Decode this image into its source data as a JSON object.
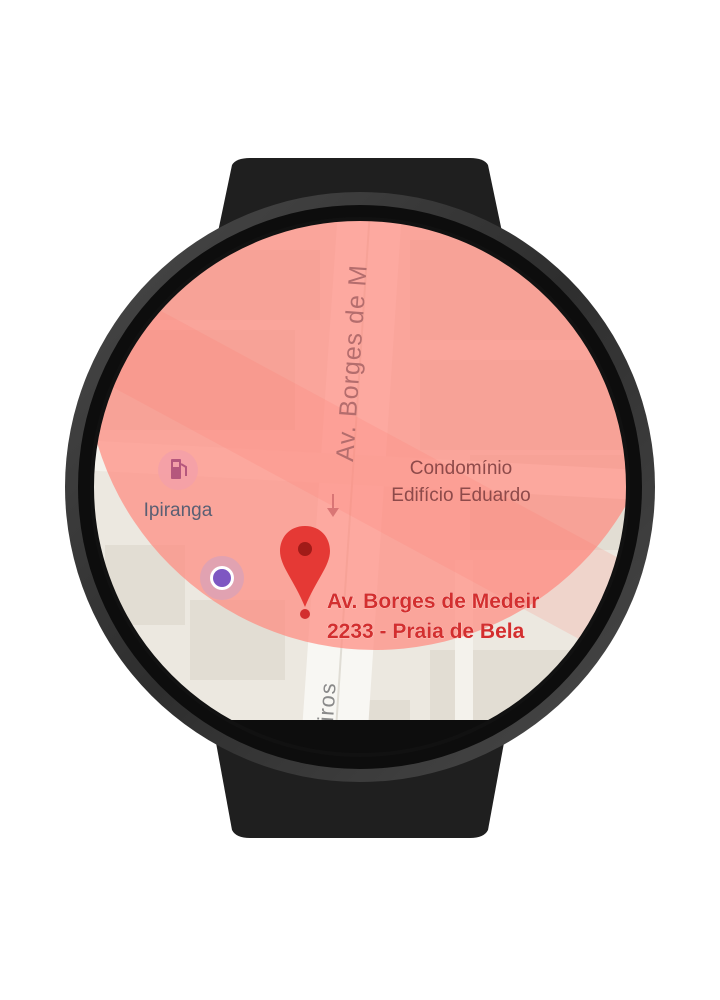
{
  "map": {
    "streets": {
      "main_vertical": "Av. Borges de M",
      "bottom_partial": "iros"
    },
    "pois": [
      {
        "label_line1": "Condomínio",
        "label_line2": "Edifício Eduardo"
      },
      {
        "label": "Ipiranga",
        "icon": "gas-station-icon"
      }
    ],
    "pin": {
      "address_line1": "Av. Borges de Medeir",
      "address_line2": "2233 - Praia de Bela",
      "icon": "map-pin-icon"
    },
    "my_location": {
      "icon": "my-location-icon"
    }
  },
  "colors": {
    "map_bg": "#ece8e0",
    "road": "#f8f7f3",
    "accuracy_circle": "#ff8a80",
    "pin_red": "#e53935",
    "address_text": "#d32f2f",
    "location_dot": "#7e57c2",
    "bezel": "#3a3a3a",
    "strap": "#1e1e1e"
  }
}
